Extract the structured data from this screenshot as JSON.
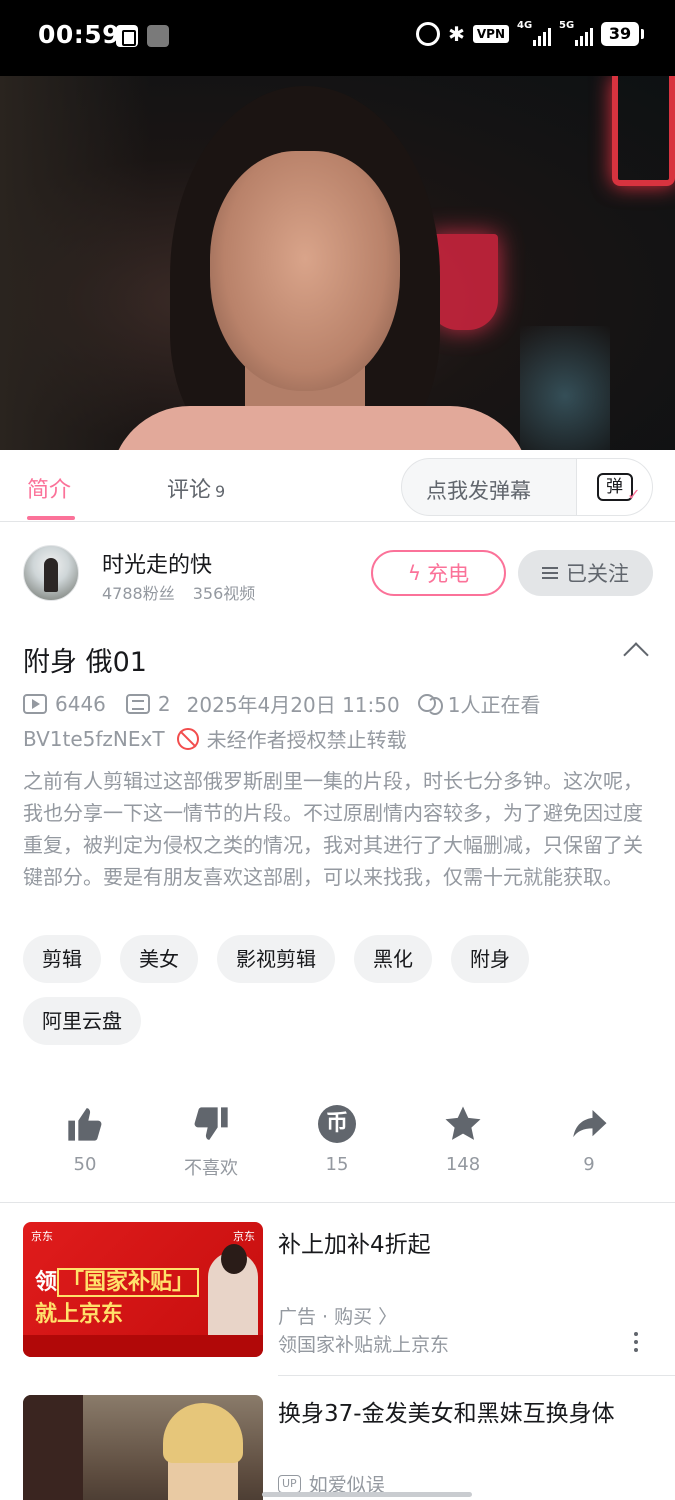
{
  "status_bar": {
    "time": "00:59",
    "vpn": "VPN",
    "net1": "4G",
    "net2": "5G",
    "battery": "39"
  },
  "tabs": {
    "intro": "简介",
    "comments": "评论",
    "comments_count": "9",
    "danmaku_placeholder": "点我发弹幕",
    "danmaku_icon_text": "弹"
  },
  "uploader": {
    "name": "时光走的快",
    "fans": "4788粉丝",
    "videos": "356视频",
    "charge_label": "充电",
    "follow_label": "已关注"
  },
  "video": {
    "title": "附身 俄01",
    "views": "6446",
    "danmaku_count": "2",
    "date": "2025年4月20日 11:50",
    "watching": "1人正在看",
    "bvid": "BV1te5fzNExT",
    "copyright": "未经作者授权禁止转载",
    "description": "之前有人剪辑过这部俄罗斯剧里一集的片段，时长七分多钟。这次呢，我也分享一下这一情节的片段。不过原剧情内容较多，为了避免因过度重复，被判定为侵权之类的情况，我对其进行了大幅删减，只保留了关键部分。要是有朋友喜欢这部剧，可以来找我，仅需十元就能获取。",
    "tags": [
      "剪辑",
      "美女",
      "影视剪辑",
      "黑化",
      "附身",
      "阿里云盘"
    ]
  },
  "actions": {
    "like": "50",
    "dislike": "不喜欢",
    "coin": "15",
    "favorite": "148",
    "share": "9"
  },
  "ad": {
    "thumb_brand": "京东",
    "thumb_brand2": "京东",
    "thumb_line1_a": "领",
    "thumb_line1_b": "「国家补贴」",
    "thumb_line2": "就上京东",
    "title": "补上加补4折起",
    "sub": "广告 · 购买 〉",
    "desc": "领国家补贴就上京东"
  },
  "recommend": {
    "title": "换身37-金发美女和黑妹互换身体",
    "up_badge": "UP",
    "up_name": "如爱似误"
  },
  "colors": {
    "accent": "#fb7299",
    "text_secondary": "#9499a0",
    "divider": "#e3e5e7"
  }
}
